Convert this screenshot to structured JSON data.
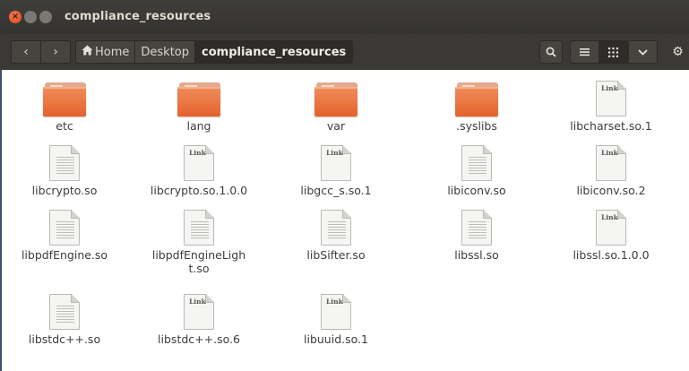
{
  "window": {
    "title": "compliance_resources",
    "buttons": {
      "close": "×",
      "minimize": "–",
      "maximize": "□"
    }
  },
  "toolbar": {
    "back_icon": "‹",
    "forward_icon": "›",
    "breadcrumbs": [
      {
        "label": "Home",
        "icon": "home-icon"
      },
      {
        "label": "Desktop"
      },
      {
        "label": "compliance_resources",
        "active": true
      }
    ],
    "search_icon": "search-icon",
    "view_list_icon": "≡",
    "view_grid_icon": "⋯",
    "view_menu_icon": "⌄",
    "settings_icon": "⚙"
  },
  "files": [
    {
      "name": "etc",
      "type": "folder"
    },
    {
      "name": "lang",
      "type": "folder"
    },
    {
      "name": "var",
      "type": "folder"
    },
    {
      "name": ".syslibs",
      "type": "folder"
    },
    {
      "name": "libcharset.so.1",
      "type": "link"
    },
    {
      "name": "libcrypto.so",
      "type": "file"
    },
    {
      "name": "libcrypto.so.1.0.0",
      "type": "link"
    },
    {
      "name": "libgcc_s.so.1",
      "type": "link"
    },
    {
      "name": "libiconv.so",
      "type": "file"
    },
    {
      "name": "libiconv.so.2",
      "type": "link"
    },
    {
      "name": "libpdfEngine.so",
      "type": "file"
    },
    {
      "name": "libpdfEngineLight.so",
      "type": "file"
    },
    {
      "name": "libSifter.so",
      "type": "file"
    },
    {
      "name": "libssl.so",
      "type": "file"
    },
    {
      "name": "libssl.so.1.0.0",
      "type": "link"
    },
    {
      "name": "libstdc++.so",
      "type": "file"
    },
    {
      "name": "libstdc++.so.6",
      "type": "link"
    },
    {
      "name": "libuuid.so.1",
      "type": "link"
    }
  ],
  "link_badge": "Link"
}
